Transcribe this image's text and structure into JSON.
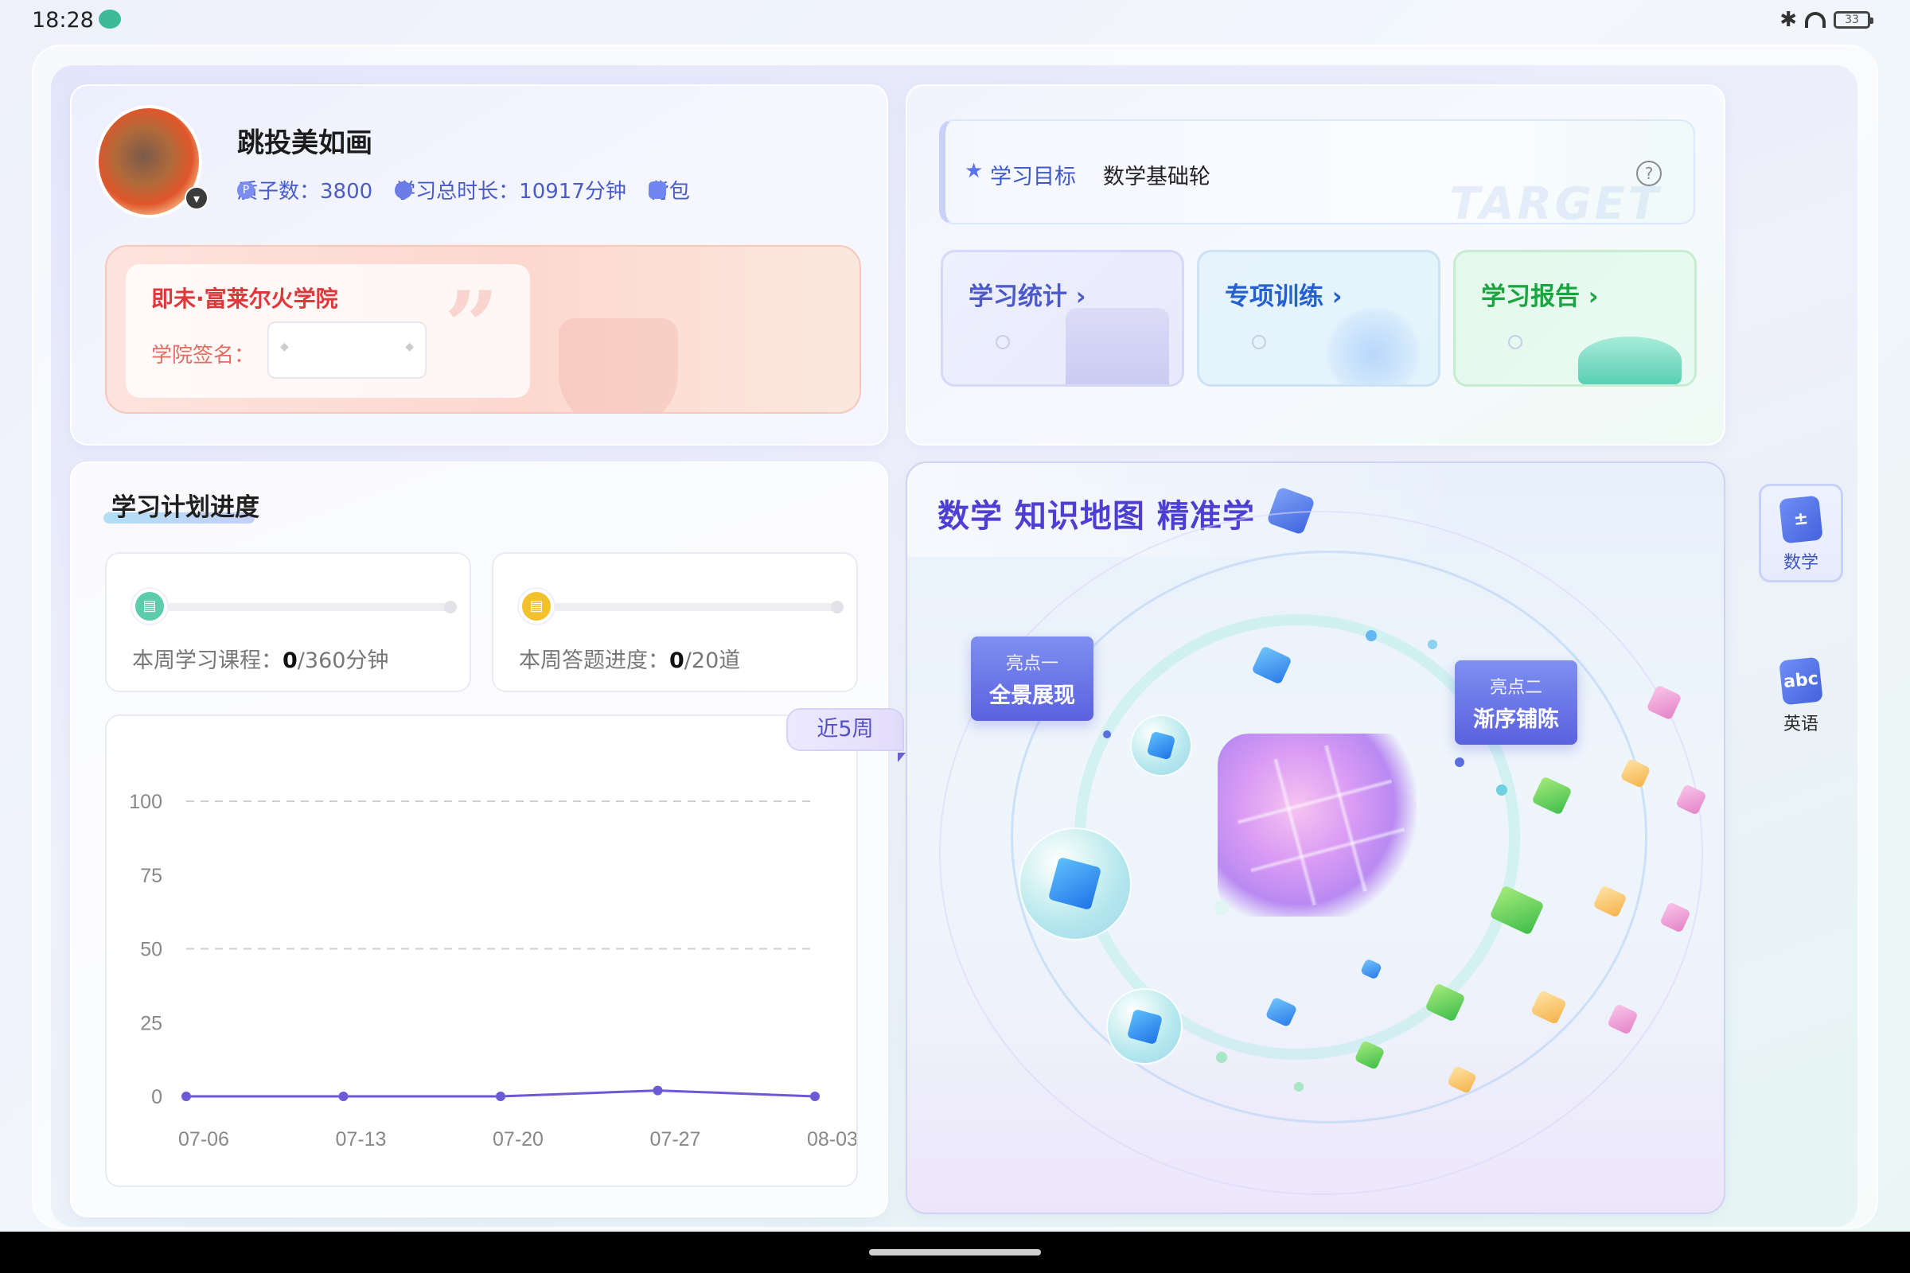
{
  "status_bar": {
    "time": "18:28",
    "battery": "33"
  },
  "profile": {
    "username": "跳投美如画",
    "stats": [
      {
        "icon": "quark-icon",
        "label": "质子数：3800"
      },
      {
        "icon": "clock-icon",
        "label": "学习总时长：10917分钟"
      },
      {
        "icon": "backpack-icon",
        "label": "背包"
      }
    ],
    "academy": {
      "name": "即未·富莱尔火学院",
      "sign_label": "学院签名："
    }
  },
  "goals": {
    "label": "学习目标",
    "value": "数学基础轮",
    "watermark": "TARGET",
    "tiles": [
      {
        "title": "学习统计",
        "color": "#4b59c9"
      },
      {
        "title": "专项训练",
        "color": "#2460d1"
      },
      {
        "title": "学习报告",
        "color": "#1aa541"
      }
    ]
  },
  "plan": {
    "title": "学习计划进度",
    "course": {
      "label": "本周学习课程：",
      "done": "0",
      "total": "/360分钟"
    },
    "questions": {
      "label": "本周答题进度：",
      "done": "0",
      "total": "/20道"
    },
    "range": "近5周"
  },
  "chart_data": {
    "type": "line",
    "categories": [
      "07-06",
      "07-13",
      "07-20",
      "07-27",
      "08-03"
    ],
    "series": [
      {
        "values": [
          0,
          0,
          0,
          2,
          0
        ],
        "color": "#6a5ad6"
      }
    ],
    "yticks": [
      0,
      25,
      50,
      75,
      100
    ],
    "ylim": [
      0,
      100
    ],
    "grid_dashed_at": [
      50,
      100
    ]
  },
  "knowledge_map": {
    "title": "数学 知识地图 精准学",
    "highlight1": {
      "sub": "亮点一",
      "main": "全景展现"
    },
    "highlight2": {
      "sub": "亮点二",
      "main": "渐序铺陈"
    }
  },
  "subjects": [
    {
      "label": "数学",
      "active": true
    },
    {
      "label": "英语",
      "active": false
    }
  ]
}
